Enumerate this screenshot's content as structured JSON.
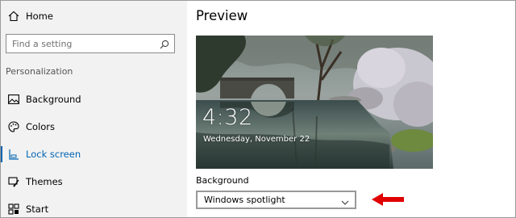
{
  "sidebar": {
    "home_label": "Home",
    "search_placeholder": "Find a setting",
    "section_title": "Personalization",
    "items": [
      {
        "label": "Background",
        "icon": "image-icon"
      },
      {
        "label": "Colors",
        "icon": "palette-icon"
      },
      {
        "label": "Lock screen",
        "icon": "lock-screen-icon",
        "active": true
      },
      {
        "label": "Themes",
        "icon": "brush-icon"
      },
      {
        "label": "Start",
        "icon": "start-grid-icon"
      }
    ]
  },
  "main": {
    "title": "Preview",
    "preview": {
      "time": "4:32",
      "date": "Wednesday, November 22"
    },
    "background_label": "Background",
    "background_value": "Windows spotlight"
  },
  "colors": {
    "accent": "#0063b1",
    "sidebar_bg": "#f2f2f2",
    "arrow": "#e00000"
  }
}
